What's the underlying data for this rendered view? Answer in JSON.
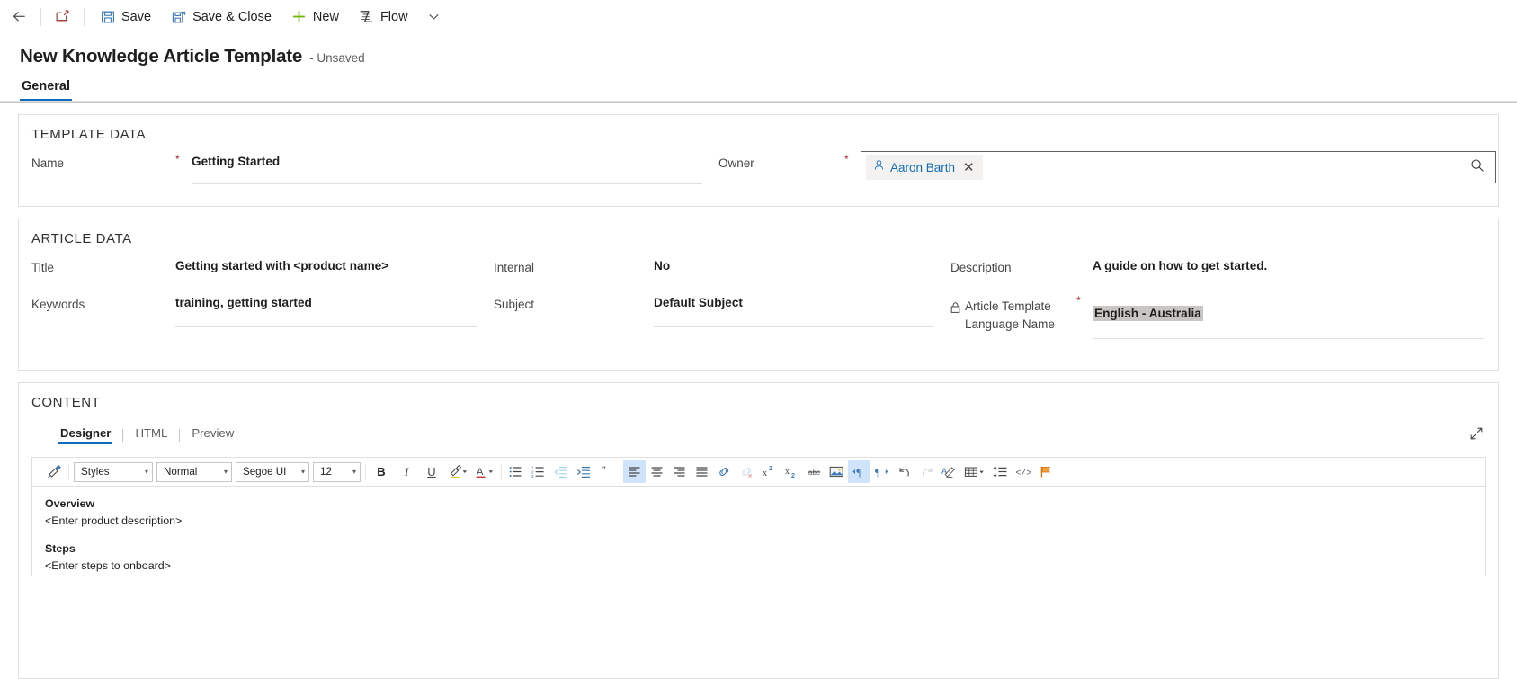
{
  "commandbar": {
    "back_label": "",
    "popout_label": "",
    "save_label": "Save",
    "save_close_label": "Save & Close",
    "new_label": "New",
    "flow_label": "Flow",
    "more_label": ""
  },
  "header": {
    "title": "New Knowledge Article Template",
    "status": "- Unsaved"
  },
  "tabs": [
    {
      "label": "General",
      "active": true
    }
  ],
  "template_data": {
    "section_title": "TEMPLATE DATA",
    "name_label": "Name",
    "name_value": "Getting Started",
    "owner_label": "Owner",
    "owner_value": "Aaron Barth"
  },
  "article_data": {
    "section_title": "ARTICLE DATA",
    "title_label": "Title",
    "title_value": "Getting started with <product name>",
    "keywords_label": "Keywords",
    "keywords_value": "training, getting started",
    "internal_label": "Internal",
    "internal_value": "No",
    "subject_label": "Subject",
    "subject_value": "Default Subject",
    "description_label": "Description",
    "description_value": "A guide on how to get started.",
    "language_label_line1": "Article Template",
    "language_label_line2": "Language Name",
    "language_value": "English - Australia"
  },
  "content": {
    "section_title": "CONTENT",
    "subtabs": [
      {
        "label": "Designer",
        "active": true
      },
      {
        "label": "HTML",
        "active": false
      },
      {
        "label": "Preview",
        "active": false
      }
    ],
    "toolbar": {
      "styles_label": "Styles",
      "format_label": "Normal",
      "font_label": "Segoe UI",
      "size_label": "12",
      "bold_label": "B",
      "italic_label": "I",
      "underline_label": "U"
    },
    "body": {
      "heading1": "Overview",
      "para1": "<Enter product description>",
      "heading2": "Steps",
      "para2": "<Enter steps to onboard>"
    }
  },
  "colors": {
    "accent": "#0f6cbd",
    "required": "#a4262c",
    "link": "#0f6cbd",
    "toolbar_active": "#cfe4fa",
    "selection": "#c8c6c4",
    "new_green": "#6bb700"
  }
}
